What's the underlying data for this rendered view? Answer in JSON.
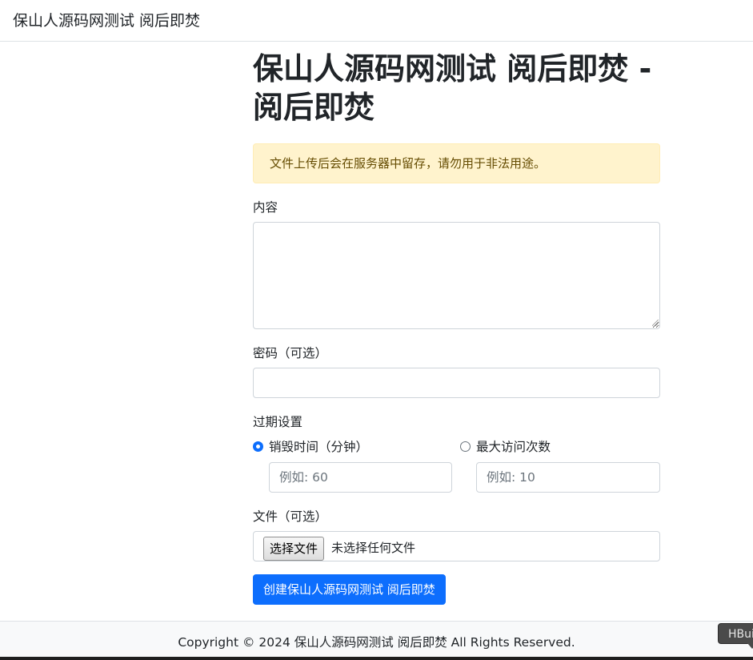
{
  "navbar": {
    "brand": "保山人源码网测试 阅后即焚"
  },
  "main": {
    "title": "保山人源码网测试 阅后即焚 - 阅后即焚",
    "alert": "文件上传后会在服务器中留存，请勿用于非法用途。",
    "content_label": "内容",
    "content_value": "",
    "password_label": "密码（可选）",
    "password_value": "",
    "expiry_label": "过期设置",
    "expiry_options": [
      {
        "label": "销毁时间（分钟）",
        "checked": true,
        "placeholder": "例如: 60"
      },
      {
        "label": "最大访问次数",
        "checked": false,
        "placeholder": "例如: 10"
      }
    ],
    "file_label": "文件（可选）",
    "file_button": "选择文件",
    "file_status": "未选择任何文件",
    "submit": "创建保山人源码网测试 阅后即焚"
  },
  "footer": {
    "copyright": "Copyright © 2024 保山人源码网测试 阅后即焚 All Rights Reserved."
  },
  "overlay": {
    "tooltip": "HBuilder"
  },
  "colors": {
    "primary": "#0d6efd",
    "alert_bg": "#fff3cd",
    "alert_text": "#664d03",
    "footer_bg": "#f8f9fa"
  }
}
